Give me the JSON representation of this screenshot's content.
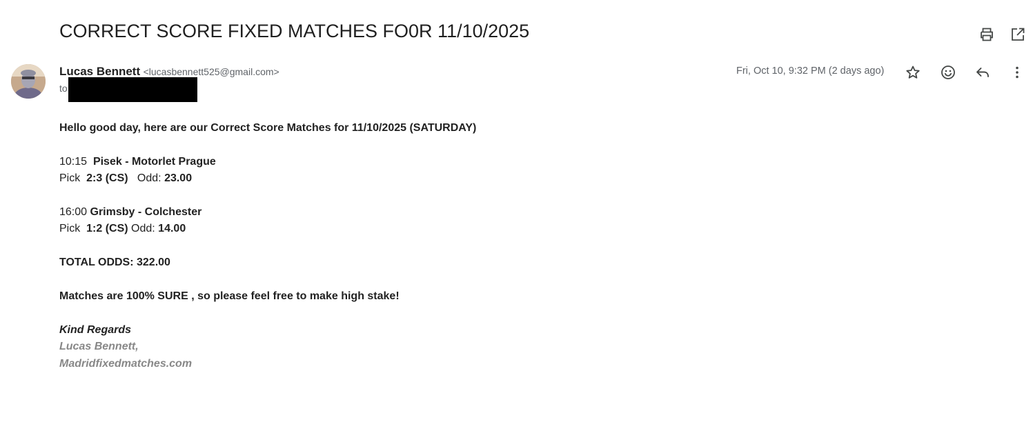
{
  "email": {
    "subject": "CORRECT SCORE FIXED MATCHES FO0R 11/10/2025",
    "sender_name": "Lucas Bennett",
    "sender_email": "<lucasbennett525@gmail.com>",
    "to_label": "to",
    "date": "Fri, Oct 10, 9:32 PM (2 days ago)"
  },
  "icons": {
    "print": "print-icon",
    "open_new_window": "open-in-new-window-icon",
    "star": "star-icon",
    "emoji": "emoji-reaction-icon",
    "reply": "reply-icon",
    "more": "more-options-icon"
  },
  "body": {
    "greeting": "Hello good day, here are our Correct Score Matches for 11/10/2025 (SATURDAY)",
    "match1": {
      "time": "10:15",
      "teams": "Pisek - Motorlet Prague",
      "pick_label": "Pick",
      "pick": "2:3 (CS)",
      "odd_label": "Odd:",
      "odd": "23.00"
    },
    "match2": {
      "time": "16:00",
      "teams": "Grimsby - Colchester",
      "pick_label": "Pick",
      "pick": "1:2 (CS)",
      "odd_label": "Odd:",
      "odd": "14.00"
    },
    "total": "TOTAL ODDS: 322.00",
    "sure": "Matches are 100% SURE , so please feel free to make high stake!",
    "regards": "Kind Regards",
    "signature_name": "Lucas Bennett,",
    "signature_site": "Madridfixedmatches.com"
  },
  "colors": {
    "text": "#222222",
    "meta": "#5f6368",
    "signature": "#888888",
    "redaction": "#000000"
  }
}
